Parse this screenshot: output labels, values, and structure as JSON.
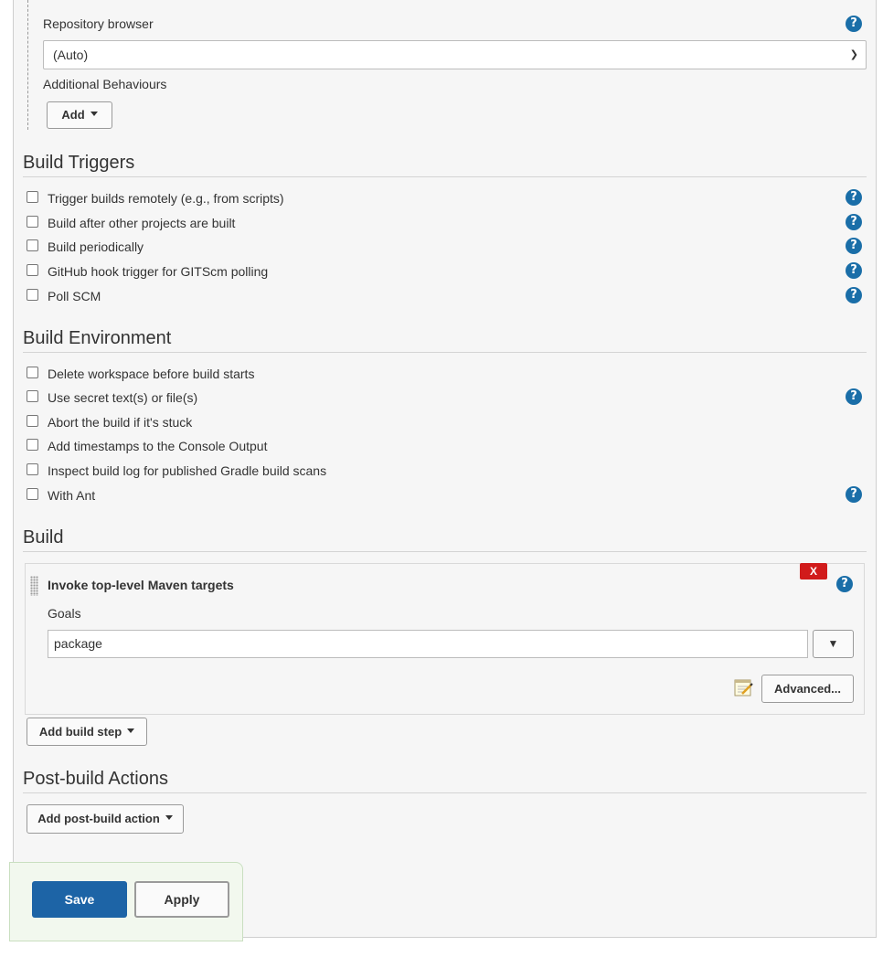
{
  "scm": {
    "repo_browser_label": "Repository browser",
    "repo_browser_value": "(Auto)",
    "additional_behaviours_label": "Additional Behaviours",
    "add_label": "Add"
  },
  "triggers": {
    "title": "Build Triggers",
    "items": [
      {
        "label": "Trigger builds remotely (e.g., from scripts)",
        "checked": false
      },
      {
        "label": "Build after other projects are built",
        "checked": false
      },
      {
        "label": "Build periodically",
        "checked": false
      },
      {
        "label": "GitHub hook trigger for GITScm polling",
        "checked": false
      },
      {
        "label": "Poll SCM",
        "checked": false
      }
    ]
  },
  "environment": {
    "title": "Build Environment",
    "items": [
      {
        "label": "Delete workspace before build starts",
        "checked": false
      },
      {
        "label": "Use secret text(s) or file(s)",
        "checked": false
      },
      {
        "label": "Abort the build if it's stuck",
        "checked": false
      },
      {
        "label": "Add timestamps to the Console Output",
        "checked": false
      },
      {
        "label": "Inspect build log for published Gradle build scans",
        "checked": false
      },
      {
        "label": "With Ant",
        "checked": false
      }
    ]
  },
  "build": {
    "title": "Build",
    "step": {
      "title": "Invoke top-level Maven targets",
      "delete_label": "X",
      "goals_label": "Goals",
      "goals_value": "package",
      "advanced_label": "Advanced..."
    },
    "add_step_label": "Add build step"
  },
  "post_build": {
    "title": "Post-build Actions",
    "add_label": "Add post-build action"
  },
  "footer": {
    "save_label": "Save",
    "apply_label": "Apply"
  },
  "icons": {
    "help": "help-icon",
    "dropdown": "dropdown-arrow-icon",
    "notepad": "notepad-icon",
    "grip": "drag-handle-icon"
  },
  "colors": {
    "help_blue": "#1a6ea8",
    "save_blue": "#1d64a6",
    "delete_red": "#d11b1b"
  }
}
